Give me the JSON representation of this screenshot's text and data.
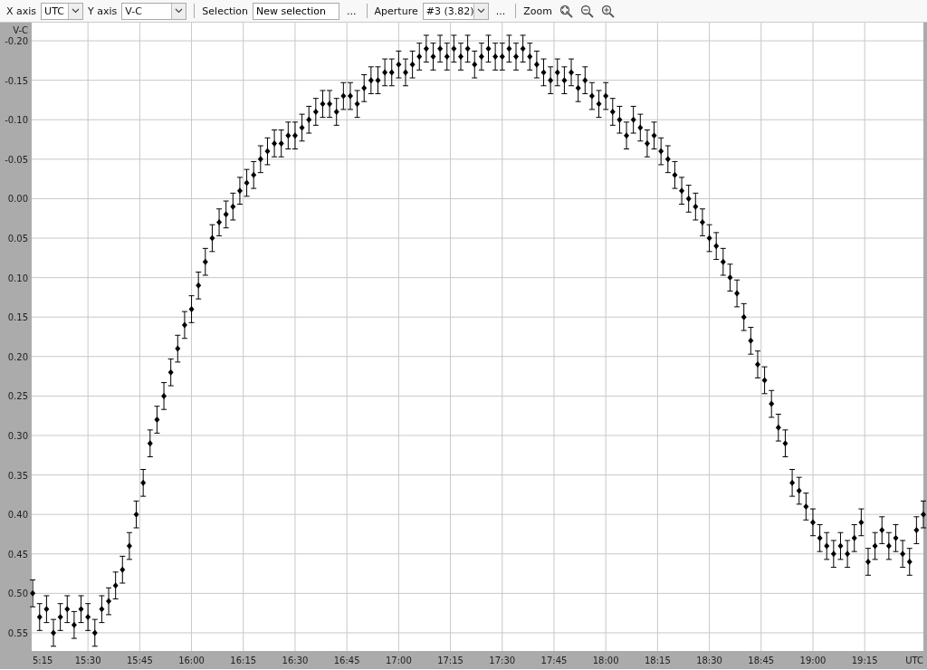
{
  "toolbar": {
    "x_axis": {
      "label": "X axis",
      "value": "UTC"
    },
    "y_axis": {
      "label": "Y axis",
      "value": "V-C"
    },
    "selection": {
      "label": "Selection",
      "value": "New selection",
      "more": "..."
    },
    "aperture": {
      "label": "Aperture",
      "value": "#3 (3.82)",
      "more": "..."
    },
    "zoom": {
      "label": "Zoom"
    }
  },
  "chart": {
    "clipped_x_label": "5:15",
    "chart_data": {
      "type": "scatter",
      "xlabel": "UTC",
      "ylabel": "V-C",
      "grid": true,
      "x": [
        914,
        916,
        918,
        920,
        922,
        924,
        926,
        928,
        930,
        932,
        934,
        936,
        938,
        940,
        942,
        944,
        946,
        948,
        950,
        952,
        954,
        956,
        958,
        960,
        962,
        964,
        966,
        968,
        970,
        972,
        974,
        976,
        978,
        980,
        982,
        984,
        986,
        988,
        990,
        992,
        994,
        996,
        998,
        1000,
        1002,
        1004,
        1006,
        1008,
        1010,
        1012,
        1014,
        1016,
        1018,
        1020,
        1022,
        1024,
        1026,
        1028,
        1030,
        1032,
        1034,
        1036,
        1038,
        1040,
        1042,
        1044,
        1046,
        1048,
        1050,
        1052,
        1054,
        1056,
        1058,
        1060,
        1062,
        1064,
        1066,
        1068,
        1070,
        1072,
        1074,
        1076,
        1078,
        1080,
        1082,
        1084,
        1086,
        1088,
        1090,
        1092,
        1094,
        1096,
        1098,
        1100,
        1102,
        1104,
        1106,
        1108,
        1110,
        1112,
        1114,
        1116,
        1118,
        1120,
        1122,
        1124,
        1126,
        1128,
        1130,
        1132,
        1134,
        1136,
        1138,
        1140,
        1142,
        1144,
        1146,
        1148,
        1150,
        1152,
        1154,
        1156,
        1158,
        1160,
        1162,
        1164,
        1166,
        1168,
        1170,
        1172
      ],
      "series": [
        {
          "color": "#000000",
          "errors": [
            0.017,
            0.017,
            0.017,
            0.017,
            0.017,
            0.017,
            0.017,
            0.017,
            0.017,
            0.017,
            0.017,
            0.017,
            0.017,
            0.017,
            0.017,
            0.017,
            0.017,
            0.017,
            0.017,
            0.017,
            0.017,
            0.017,
            0.017,
            0.017,
            0.017,
            0.017,
            0.017,
            0.017,
            0.017,
            0.017,
            0.017,
            0.017,
            0.017,
            0.017,
            0.017,
            0.017,
            0.017,
            0.017,
            0.017,
            0.017,
            0.017,
            0.017,
            0.017,
            0.017,
            0.017,
            0.017,
            0.017,
            0.017,
            0.017,
            0.017,
            0.017,
            0.017,
            0.017,
            0.017,
            0.017,
            0.017,
            0.017,
            0.017,
            0.017,
            0.017,
            0.017,
            0.017,
            0.017,
            0.017,
            0.017,
            0.017,
            0.017,
            0.017,
            0.017,
            0.017,
            0.017,
            0.017,
            0.017,
            0.017,
            0.017,
            0.017,
            0.017,
            0.017,
            0.017,
            0.017,
            0.017,
            0.017,
            0.017,
            0.017,
            0.017,
            0.017,
            0.017,
            0.017,
            0.017,
            0.017,
            0.017,
            0.017,
            0.017,
            0.017,
            0.017,
            0.017,
            0.017,
            0.017,
            0.017,
            0.017,
            0.017,
            0.017,
            0.017,
            0.017,
            0.017,
            0.017,
            0.017,
            0.017,
            0.017,
            0.017,
            0.017,
            0.017,
            0.017,
            0.017,
            0.017,
            0.017,
            0.017,
            0.017,
            0.017,
            0.017,
            0.017,
            0.017,
            0.017,
            0.017,
            0.017,
            0.017,
            0.017,
            0.017,
            0.017,
            0.017
          ],
          "values": [
            0.5,
            0.53,
            0.52,
            0.55,
            0.53,
            0.52,
            0.54,
            0.52,
            0.53,
            0.55,
            0.52,
            0.51,
            0.49,
            0.47,
            0.44,
            0.4,
            0.36,
            0.31,
            0.28,
            0.25,
            0.22,
            0.19,
            0.16,
            0.14,
            0.11,
            0.08,
            0.05,
            0.03,
            0.02,
            0.01,
            -0.01,
            -0.02,
            -0.03,
            -0.05,
            -0.06,
            -0.07,
            -0.07,
            -0.08,
            -0.08,
            -0.09,
            -0.1,
            -0.11,
            -0.12,
            -0.12,
            -0.11,
            -0.13,
            -0.13,
            -0.12,
            -0.14,
            -0.15,
            -0.15,
            -0.16,
            -0.16,
            -0.17,
            -0.16,
            -0.17,
            -0.18,
            -0.19,
            -0.18,
            -0.19,
            -0.18,
            -0.19,
            -0.18,
            -0.19,
            -0.17,
            -0.18,
            -0.19,
            -0.18,
            -0.18,
            -0.19,
            -0.18,
            -0.19,
            -0.18,
            -0.17,
            -0.16,
            -0.15,
            -0.16,
            -0.15,
            -0.16,
            -0.14,
            -0.15,
            -0.13,
            -0.12,
            -0.13,
            -0.11,
            -0.1,
            -0.08,
            -0.1,
            -0.09,
            -0.07,
            -0.08,
            -0.06,
            -0.05,
            -0.03,
            -0.01,
            0.0,
            0.01,
            0.03,
            0.05,
            0.06,
            0.08,
            0.1,
            0.12,
            0.15,
            0.18,
            0.21,
            0.23,
            0.26,
            0.29,
            0.31,
            0.36,
            0.37,
            0.39,
            0.41,
            0.43,
            0.44,
            0.45,
            0.44,
            0.45,
            0.43,
            0.41,
            0.46,
            0.44,
            0.42,
            0.44,
            0.43,
            0.45,
            0.46,
            0.42,
            0.4
          ]
        }
      ],
      "xlim": [
        914,
        1172
      ],
      "ylim": [
        0.573,
        -0.223
      ],
      "xticks": [
        {
          "value": 930,
          "label": "15:30"
        },
        {
          "value": 945,
          "label": "15:45"
        },
        {
          "value": 960,
          "label": "16:00"
        },
        {
          "value": 975,
          "label": "16:15"
        },
        {
          "value": 990,
          "label": "16:30"
        },
        {
          "value": 1005,
          "label": "16:45"
        },
        {
          "value": 1020,
          "label": "17:00"
        },
        {
          "value": 1035,
          "label": "17:15"
        },
        {
          "value": 1050,
          "label": "17:30"
        },
        {
          "value": 1065,
          "label": "17:45"
        },
        {
          "value": 1080,
          "label": "18:00"
        },
        {
          "value": 1095,
          "label": "18:15"
        },
        {
          "value": 1110,
          "label": "18:30"
        },
        {
          "value": 1125,
          "label": "18:45"
        },
        {
          "value": 1140,
          "label": "19:00"
        },
        {
          "value": 1155,
          "label": "19:15"
        }
      ],
      "yticks": [
        {
          "value": -0.2,
          "label": "-0.20"
        },
        {
          "value": -0.15,
          "label": "-0.15"
        },
        {
          "value": -0.1,
          "label": "-0.10"
        },
        {
          "value": -0.05,
          "label": "-0.05"
        },
        {
          "value": 0,
          "label": "0.00"
        },
        {
          "value": 0.05,
          "label": "0.05"
        },
        {
          "value": 0.1,
          "label": "0.10"
        },
        {
          "value": 0.15,
          "label": "0.15"
        },
        {
          "value": 0.2,
          "label": "0.20"
        },
        {
          "value": 0.25,
          "label": "0.25"
        },
        {
          "value": 0.3,
          "label": "0.30"
        },
        {
          "value": 0.35,
          "label": "0.35"
        },
        {
          "value": 0.4,
          "label": "0.40"
        },
        {
          "value": 0.45,
          "label": "0.45"
        },
        {
          "value": 0.5,
          "label": "0.50"
        },
        {
          "value": 0.55,
          "label": "0.55"
        }
      ]
    }
  }
}
